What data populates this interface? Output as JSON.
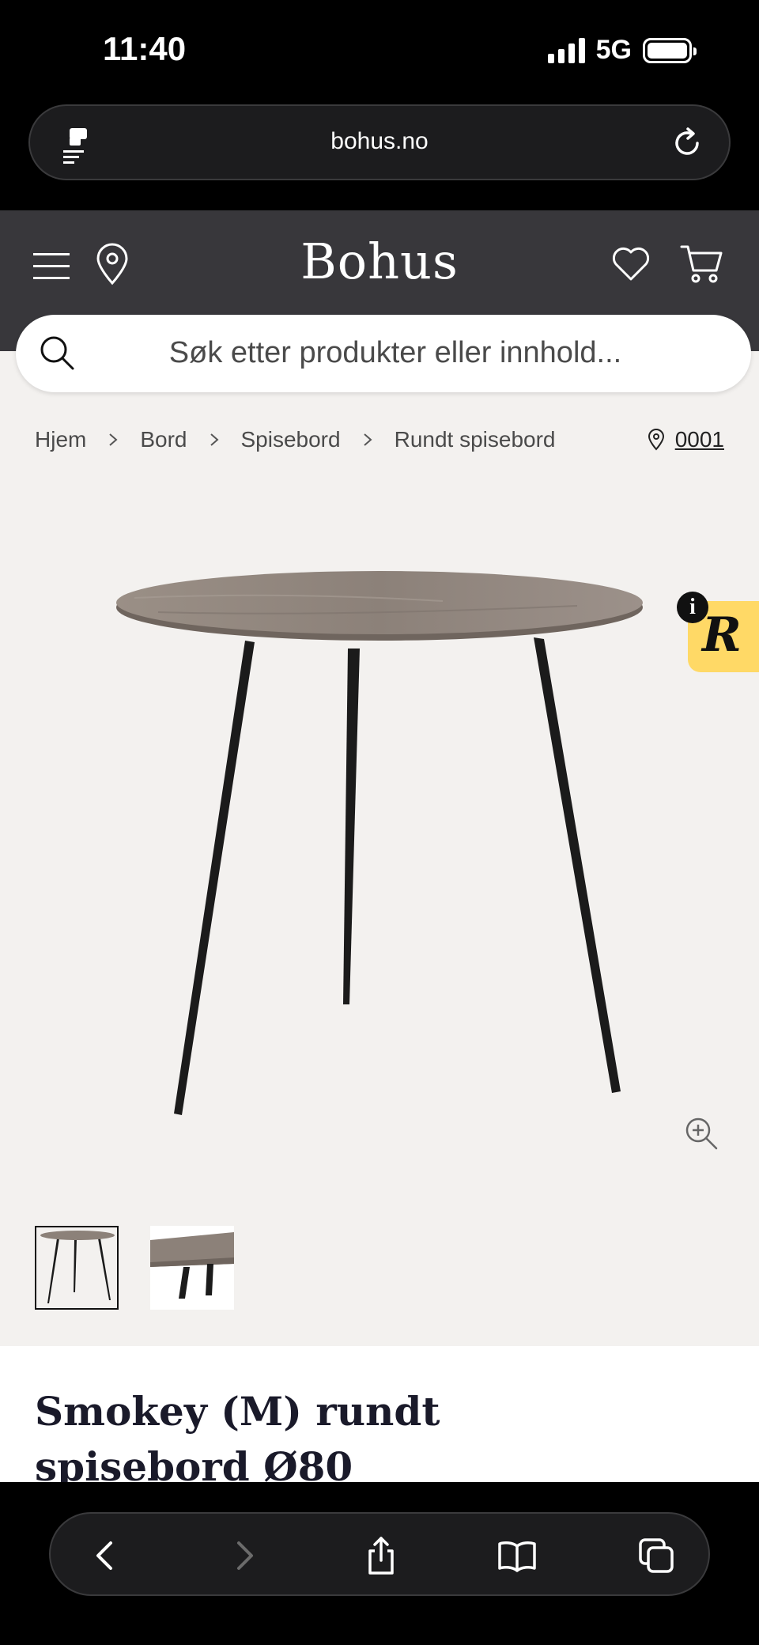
{
  "status": {
    "time": "11:40",
    "network": "5G"
  },
  "browser": {
    "url": "bohus.no"
  },
  "header": {
    "logo": "Bohus"
  },
  "search": {
    "placeholder": "Søk etter produkter eller innhold..."
  },
  "breadcrumb": {
    "items": [
      "Hjem",
      "Bord",
      "Spisebord",
      "Rundt spisebord"
    ]
  },
  "store": {
    "code": "0001"
  },
  "product": {
    "title_line1": "Smokey (M) rundt",
    "title_line2": "spisebord Ø80",
    "thumbnail_count": 2
  },
  "badge": {
    "letter": "R",
    "info": "i"
  },
  "icons": {
    "menu": "menu-icon",
    "location": "location-pin-icon",
    "wishlist": "heart-icon",
    "cart": "cart-icon",
    "search": "search-icon",
    "zoom": "zoom-in-icon",
    "reload": "reload-icon",
    "back": "back-chevron-icon",
    "forward": "forward-chevron-icon",
    "share": "share-icon",
    "bookmarks": "book-icon",
    "tabs": "tabs-icon"
  },
  "colors": {
    "header_bg": "#38373b",
    "page_bg": "#f3f1ef",
    "badge": "#ffd966",
    "title": "#1a1a2a"
  }
}
